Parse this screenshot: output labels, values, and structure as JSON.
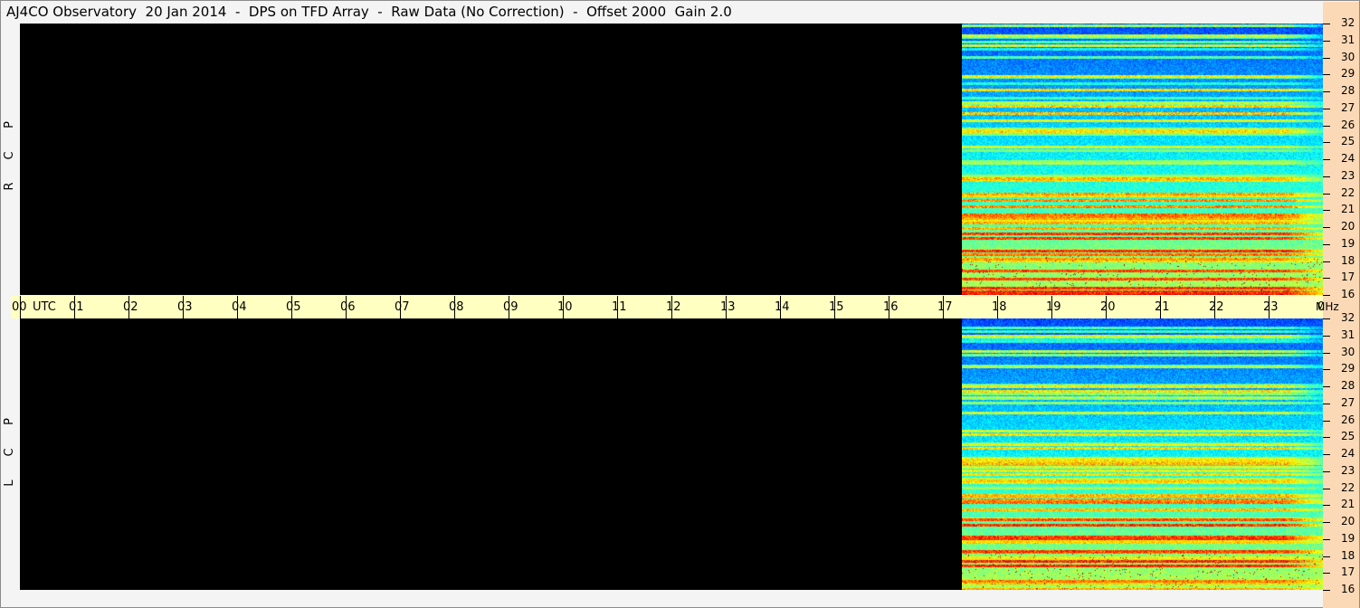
{
  "window": {
    "title": "AJ4CO Observatory  20 Jan 2014  -  DPS on TFD Array  -  Raw Data (No Correction)  -  Offset 2000  Gain 2.0"
  },
  "panels": [
    {
      "label": [
        "R",
        "C",
        "P"
      ]
    },
    {
      "label": [
        "L",
        "C",
        "P"
      ]
    }
  ],
  "time_axis": {
    "labels": [
      "00",
      "01",
      "02",
      "03",
      "04",
      "05",
      "06",
      "07",
      "08",
      "09",
      "10",
      "11",
      "12",
      "13",
      "14",
      "15",
      "16",
      "17",
      "18",
      "19",
      "20",
      "21",
      "22",
      "23",
      "00"
    ],
    "utc_label": "UTC",
    "mhz_label": "MHz"
  },
  "freq_axis": {
    "labels": [
      "32",
      "31",
      "30",
      "29",
      "28",
      "27",
      "26",
      "25",
      "24",
      "23",
      "22",
      "21",
      "20",
      "19",
      "18",
      "17",
      "16"
    ]
  },
  "colors": {
    "background": "#f4f4f4",
    "time_bar": "#ffffc2",
    "freq_bar": "#fcd9b6",
    "no_data": "#000000"
  }
}
